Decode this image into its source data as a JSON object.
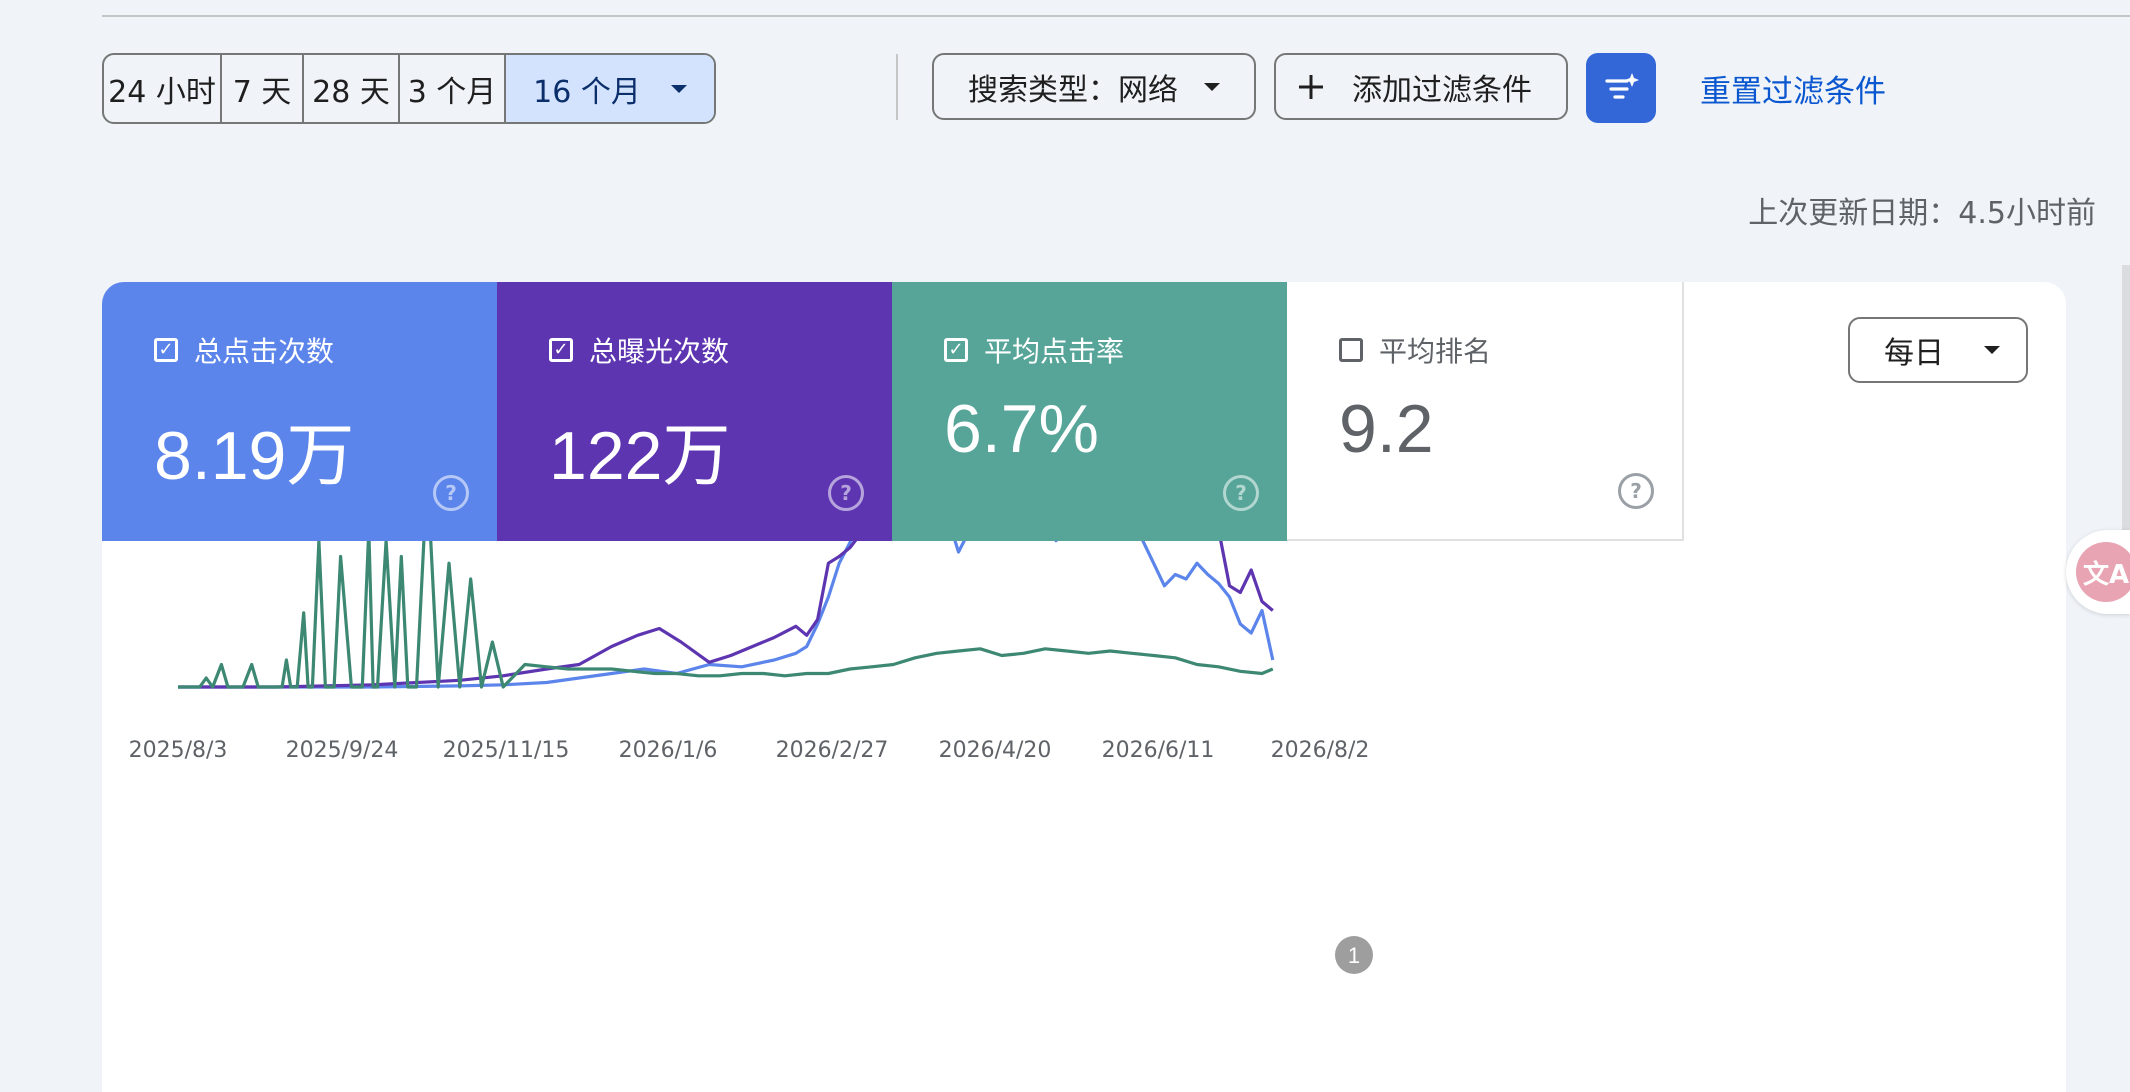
{
  "toolbar": {
    "ranges": [
      "24 小时",
      "7 天",
      "28 天",
      "3 个月",
      "16 个月"
    ],
    "active_range": "16 个月",
    "search_type": "搜索类型：网络",
    "add_filter": "添加过滤条件",
    "reset_filter": "重置过滤条件"
  },
  "last_updated": "上次更新日期：4.5小时前",
  "metrics": [
    {
      "label": "总点击次数",
      "value": "8.19万",
      "checked": true,
      "color": "#5b85eb"
    },
    {
      "label": "总曝光次数",
      "value": "122万",
      "checked": true,
      "color": "#5e35b1"
    },
    {
      "label": "平均点击率",
      "value": "6.7%",
      "checked": true,
      "color": "#56a598"
    },
    {
      "label": "平均排名",
      "value": "9.2",
      "checked": false,
      "color": "#ffffff"
    }
  ],
  "frequency": "每日",
  "annotation_badge": "1",
  "chart_data": {
    "type": "line",
    "x_tick_labels": [
      "2025/8/3",
      "2025/9/24",
      "2025/11/15",
      "2026/1/6",
      "2026/2/27",
      "2026/4/20",
      "2026/6/11",
      "2026/8/2"
    ],
    "x_range": [
      "2025/8/3",
      "2026/9/13"
    ],
    "y_axis_labels_shown": false,
    "grid": false,
    "series": [
      {
        "name": "总点击次数",
        "color": "#5b85eb",
        "x_days": [
          0,
          45,
          90,
          130,
          150,
          170,
          185,
          200,
          215,
          230,
          245,
          260,
          275,
          285,
          290,
          295,
          300,
          305,
          312,
          318,
          325,
          332,
          340,
          346,
          352,
          360,
          368,
          372,
          377,
          382,
          387,
          392,
          398,
          405,
          410,
          415,
          420,
          425,
          430,
          435,
          440,
          445,
          450,
          455,
          460,
          465,
          470,
          475,
          480,
          485,
          490,
          495,
          500,
          505
        ],
        "values": [
          0,
          0,
          0,
          0.5,
          1,
          2,
          4,
          6,
          8,
          6,
          10,
          9,
          12,
          15,
          18,
          28,
          40,
          55,
          68,
          82,
          87,
          85,
          80,
          88,
          85,
          60,
          75,
          68,
          78,
          90,
          86,
          75,
          80,
          65,
          70,
          72,
          80,
          76,
          82,
          85,
          80,
          65,
          55,
          45,
          50,
          48,
          55,
          50,
          46,
          40,
          28,
          24,
          34,
          12
        ]
      },
      {
        "name": "总曝光次数",
        "color": "#5e35b1",
        "x_days": [
          0,
          45,
          90,
          130,
          150,
          170,
          185,
          200,
          212,
          222,
          232,
          245,
          255,
          265,
          275,
          285,
          290,
          295,
          300,
          305,
          310,
          318,
          325,
          332,
          340,
          346,
          352,
          360,
          368,
          372,
          377,
          382,
          387,
          392,
          398,
          405,
          410,
          415,
          420,
          425,
          430,
          435,
          440,
          445,
          450,
          455,
          460,
          465,
          470,
          475,
          480,
          485,
          490,
          495,
          500,
          505
        ],
        "values": [
          0,
          0,
          1,
          3,
          5,
          8,
          10,
          18,
          23,
          26,
          20,
          11,
          14,
          18,
          22,
          27,
          23,
          30,
          55,
          58,
          62,
          72,
          95,
          91,
          88,
          96,
          93,
          80,
          85,
          78,
          87,
          95,
          92,
          80,
          86,
          72,
          78,
          80,
          88,
          84,
          90,
          96,
          88,
          80,
          70,
          78,
          80,
          84,
          90,
          82,
          70,
          45,
          42,
          52,
          38,
          34
        ]
      },
      {
        "name": "平均点击率",
        "color": "#3d8872",
        "x_days": [
          0,
          10,
          13,
          16,
          20,
          23,
          30,
          34,
          37,
          40,
          45,
          48,
          50,
          52,
          55,
          58,
          60,
          62,
          65,
          68,
          72,
          75,
          80,
          85,
          88,
          90,
          92,
          96,
          100,
          103,
          106,
          110,
          115,
          120,
          125,
          130,
          135,
          140,
          145,
          150,
          160,
          170,
          180,
          190,
          200,
          210,
          220,
          230,
          240,
          250,
          260,
          270,
          280,
          290,
          300,
          310,
          320,
          330,
          340,
          350,
          360,
          370,
          380,
          390,
          400,
          410,
          420,
          430,
          440,
          450,
          460,
          470,
          480,
          490,
          500,
          505
        ],
        "values": [
          0,
          0,
          4,
          0,
          10,
          0,
          0,
          10,
          0,
          0,
          0,
          0,
          12,
          0,
          0,
          33,
          0,
          0,
          65,
          0,
          0,
          58,
          0,
          0,
          70,
          0,
          0,
          65,
          0,
          58,
          0,
          0,
          95,
          0,
          55,
          0,
          48,
          0,
          20,
          0,
          10,
          9,
          8,
          8,
          8,
          7,
          6,
          6,
          5,
          5,
          6,
          6,
          5,
          6,
          6,
          8,
          9,
          10,
          13,
          15,
          16,
          17,
          14,
          15,
          17,
          16,
          15,
          16,
          15,
          14,
          13,
          10,
          9,
          7,
          6,
          8
        ]
      }
    ]
  }
}
